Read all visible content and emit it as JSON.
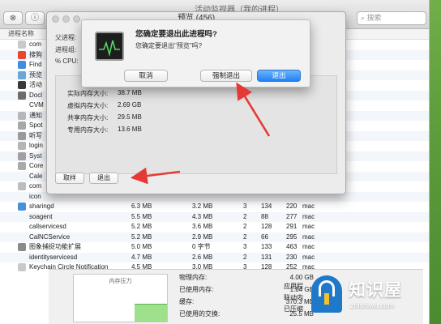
{
  "window": {
    "title": "活动监视器（我的进程）"
  },
  "toolbar": {
    "close_glyph": "⊗",
    "info_glyph": "ⓘ",
    "search_placeholder": "搜索"
  },
  "columns": {
    "process_name": "进程名称"
  },
  "processes": [
    {
      "name": "com",
      "icon_color": "#c9c9c9"
    },
    {
      "name": "搜狗",
      "icon_color": "#e7492f"
    },
    {
      "name": "Find",
      "icon_color": "#3e8ee6"
    },
    {
      "name": "预览",
      "icon_color": "#6aa6d6"
    },
    {
      "name": "活动",
      "icon_color": "#3a3a3a"
    },
    {
      "name": "Docl",
      "icon_color": "#6b6b6b"
    },
    {
      "name": "CVM",
      "icon_color": ""
    },
    {
      "name": "通知",
      "icon_color": "#b7b7b7"
    },
    {
      "name": "Spot",
      "icon_color": "#a8a8a8"
    },
    {
      "name": "听写",
      "icon_color": "#9a9a9a"
    },
    {
      "name": "login",
      "icon_color": "#b5b5b5"
    },
    {
      "name": "Syst",
      "icon_color": "#a0a0a0"
    },
    {
      "name": "Core",
      "icon_color": "#aaaaaa"
    },
    {
      "name": "Cale",
      "icon_color": ""
    },
    {
      "name": "com",
      "icon_color": "#bdbdbd"
    },
    {
      "name": "icon",
      "icon_color": ""
    },
    {
      "name": "sharingd",
      "mem": "6.3 MB",
      "comp": "3.2 MB",
      "threads": "3",
      "ports": "134",
      "pid": "220",
      "user": "mac",
      "icon_color": "#4a90d9"
    },
    {
      "name": "soagent",
      "mem": "5.5 MB",
      "comp": "4.3 MB",
      "threads": "2",
      "ports": "88",
      "pid": "277",
      "user": "mac",
      "icon_color": ""
    },
    {
      "name": "callservicesd",
      "mem": "5.2 MB",
      "comp": "3.6 MB",
      "threads": "2",
      "ports": "128",
      "pid": "291",
      "user": "mac",
      "icon_color": ""
    },
    {
      "name": "CalNCService",
      "mem": "5.2 MB",
      "comp": "2.9 MB",
      "threads": "2",
      "ports": "66",
      "pid": "295",
      "user": "mac",
      "icon_color": ""
    },
    {
      "name": "图象捕捉功能扩展",
      "mem": "5.0 MB",
      "comp": "0 字节",
      "threads": "3",
      "ports": "133",
      "pid": "463",
      "user": "mac",
      "icon_color": "#8b8b8b"
    },
    {
      "name": "identityservicesd",
      "mem": "4.7 MB",
      "comp": "2.6 MB",
      "threads": "2",
      "ports": "131",
      "pid": "230",
      "user": "mac",
      "icon_color": ""
    },
    {
      "name": "Keychain Circle Notification",
      "mem": "4.5 MB",
      "comp": "3.0 MB",
      "threads": "3",
      "ports": "128",
      "pid": "252",
      "user": "mac",
      "icon_color": "#c9c9c9"
    }
  ],
  "memory_panel": {
    "pressure_title": "内存压力",
    "stats": [
      {
        "label": "物理内存:",
        "value": "4.00 GB"
      },
      {
        "label": "已使用内存:",
        "value": "1.84 GB"
      },
      {
        "label": "缓存:",
        "value": "370.3 MB"
      },
      {
        "label": "已使用的交换:",
        "value": "25.5 MB"
      }
    ],
    "side_labels": [
      "应用程",
      "联动内",
      "已压缩"
    ]
  },
  "preview_sheet": {
    "title": "预览 (456)",
    "parent_label": "父进程:",
    "group_label": "进程组:",
    "cpu_label": "% CPU:",
    "stats": [
      {
        "label": "实际内存大小:",
        "value": "38.7 MB"
      },
      {
        "label": "虚拟内存大小:",
        "value": "2.69 GB"
      },
      {
        "label": "共享内存大小:",
        "value": "29.5 MB"
      },
      {
        "label": "专用内存大小:",
        "value": "13.6 MB"
      }
    ],
    "sample_button": "取样",
    "quit_button": "退出"
  },
  "quit_alert": {
    "title": "您确定要退出此进程吗?",
    "message": "您确定要退出\"预览\"吗?",
    "cancel": "取消",
    "force_quit": "强制退出",
    "quit": "退出"
  },
  "watermark": {
    "brand": "知识屋",
    "url": "zhishiwu.com"
  },
  "colors": {
    "accent": "#1f83f5",
    "arrow": "#e53935",
    "memory_green": "#9ee08c"
  }
}
